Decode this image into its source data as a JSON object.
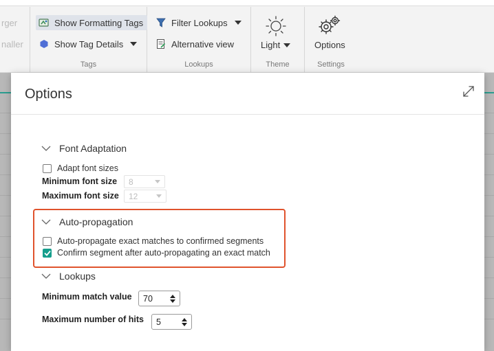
{
  "ribbon": {
    "partial_left": {
      "line1": "rger",
      "line2": "naller"
    },
    "tags": {
      "show_formatting_tags": "Show Formatting Tags",
      "show_tag_details": "Show Tag Details",
      "group_label": "Tags"
    },
    "lookups": {
      "filter_lookups": "Filter Lookups",
      "alternative_view": "Alternative view",
      "group_label": "Lookups"
    },
    "theme": {
      "button_label": "Light",
      "group_label": "Theme"
    },
    "settings": {
      "button_label": "Options",
      "group_label": "Settings"
    }
  },
  "dialog": {
    "title": "Options",
    "font_adaptation": {
      "heading": "Font Adaptation",
      "adapt_font_sizes": {
        "label": "Adapt font sizes",
        "checked": false
      },
      "min_font_size": {
        "label": "Minimum font size",
        "value": "8"
      },
      "max_font_size": {
        "label": "Maximum font size",
        "value": "12"
      }
    },
    "auto_propagation": {
      "heading": "Auto-propagation",
      "option1": {
        "label": "Auto-propagate exact matches to confirmed segments",
        "checked": false
      },
      "option2": {
        "label": "Confirm segment after auto-propagating an exact match",
        "checked": true
      }
    },
    "lookups": {
      "heading": "Lookups",
      "min_match_value": {
        "label": "Minimum match value",
        "value": "70"
      },
      "max_hits": {
        "label": "Maximum number of hits",
        "value": "5"
      }
    }
  },
  "colors": {
    "accent_teal": "#159e8c",
    "highlight": "#e0522c",
    "ribbon_bg": "#f3f3f3"
  }
}
